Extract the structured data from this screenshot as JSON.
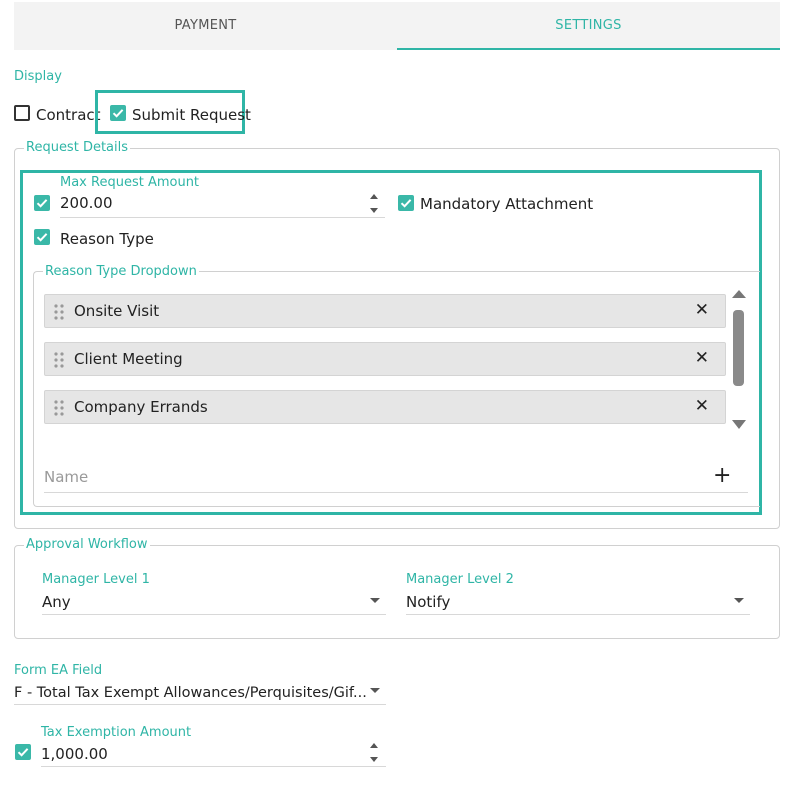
{
  "tabs": {
    "payment": "PAYMENT",
    "settings": "SETTINGS"
  },
  "display": {
    "label": "Display",
    "contract": {
      "label": "Contract",
      "checked": false
    },
    "submit_request": {
      "label": "Submit Request",
      "checked": true
    }
  },
  "request_details": {
    "legend": "Request Details",
    "max_request_amount": {
      "label": "Max Request Amount",
      "value": "200.00",
      "checked": true
    },
    "mandatory_attachment": {
      "label": "Mandatory Attachment",
      "checked": true
    },
    "reason_type": {
      "label": "Reason Type",
      "checked": true
    },
    "reason_type_dropdown": {
      "legend": "Reason Type Dropdown",
      "items": [
        "Onsite Visit",
        "Client Meeting",
        "Company Errands"
      ],
      "name_placeholder": "Name"
    }
  },
  "approval_workflow": {
    "legend": "Approval Workflow",
    "manager_level_1": {
      "label": "Manager Level 1",
      "value": "Any"
    },
    "manager_level_2": {
      "label": "Manager Level 2",
      "value": "Notify"
    }
  },
  "form_ea_field": {
    "label": "Form EA Field",
    "value": "F - Total Tax Exempt Allowances/Perquisites/Gif..."
  },
  "tax_exemption_amount": {
    "label": "Tax Exemption Amount",
    "value": "1,000.00",
    "checked": true
  },
  "colors": {
    "accent": "#2fb5a6",
    "chip_bg": "#e6e6e6"
  }
}
